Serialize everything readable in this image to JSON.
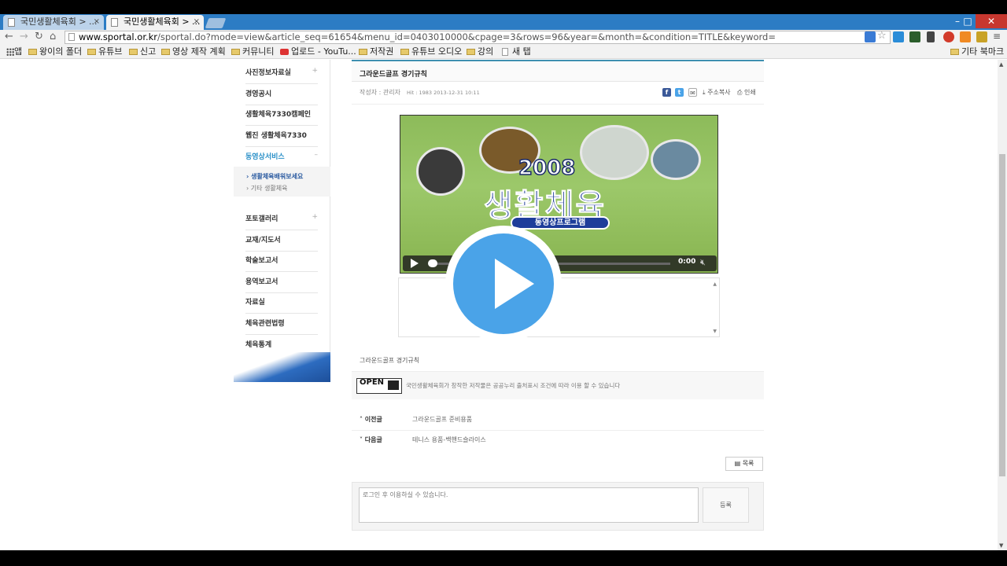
{
  "browser": {
    "tabs": [
      {
        "label": "국민생활체육회 > ...",
        "close": "×"
      },
      {
        "label": "국민생활체육회 > ...",
        "close": "×"
      }
    ],
    "url_host": "www.sportal.or.kr",
    "url_rest": "/sportal.do?mode=view&article_seq=61654&menu_id=0403010000&cpage=3&rows=96&year=&month=&condition=TITLE&keyword=",
    "bookmarks": [
      "앱",
      "왕이의 폴더",
      "유튜브",
      "신고",
      "영상 제작 계획",
      "커뮤니티",
      "업로드 - YouTu...",
      "저작권",
      "유튜브 오디오",
      "강의",
      "새 탭"
    ],
    "other_bookmarks": "기타 북마크"
  },
  "sidebar": {
    "items": [
      "사진정보자료실",
      "경영공시",
      "생활체육7330캠페인",
      "웹진 생활체육7330",
      "동영상서비스",
      "포토갤러리",
      "교재/지도서",
      "학술보고서",
      "용역보고서",
      "자료실",
      "체육관련법령",
      "체육통계"
    ],
    "sub_items": [
      "생활체육배워보세요",
      "기타 생활체육"
    ]
  },
  "article": {
    "title": "그라운드골프 경기규칙",
    "author": "작성자 : 관리자",
    "hit": "Hit : 1983  2013-12-31 10:11",
    "address_copy": "주소복사",
    "print": "인쇄",
    "caption": "그라운드골프 경기규칙",
    "license_text": "국민생활체육회가 창작한 저작물은 공공누리 출처표시 조건에 따라 이용 할 수 있습니다",
    "open_badge": "OPEN"
  },
  "video": {
    "year": "2008",
    "title": "생활체육",
    "banner": "동영상프로그램",
    "time": "0:00"
  },
  "post_nav": [
    {
      "label": "이전글",
      "value": "그라운드골프 준비용품"
    },
    {
      "label": "다음글",
      "value": "테니스 용품-백핸드슬라이스"
    }
  ],
  "list_button": "목록",
  "comment": {
    "placeholder": "로그인 후 이용하실 수 있습니다.",
    "submit": "등록"
  }
}
